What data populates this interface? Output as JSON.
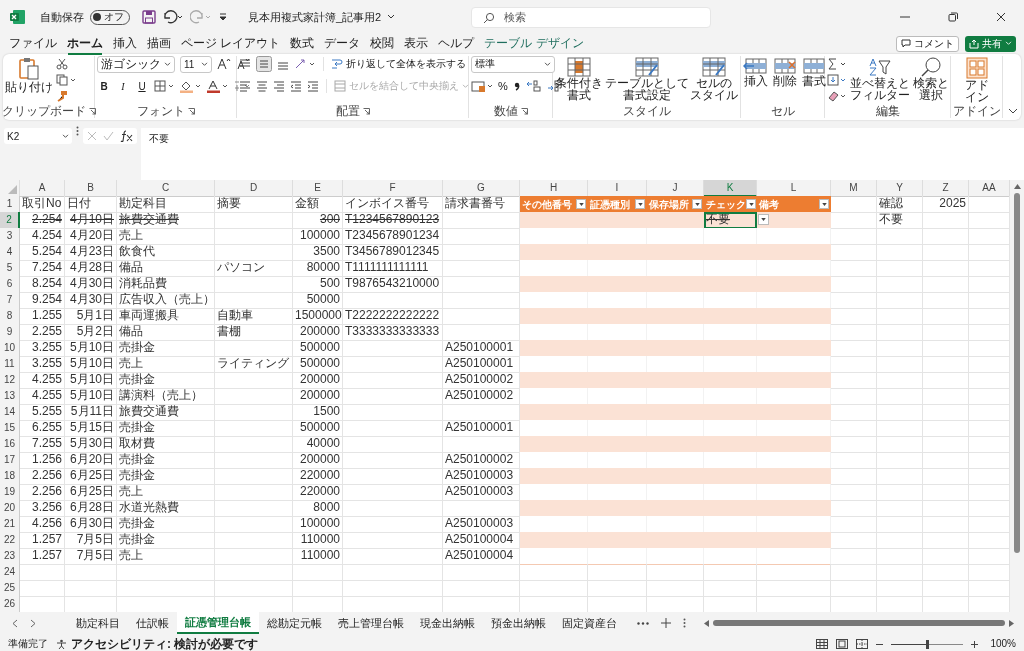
{
  "title_bar": {
    "autosave_label": "自動保存",
    "autosave": {
      "label": "オフ",
      "on": false
    },
    "file_name": "見本用複式家計簿_記事用2",
    "search": {
      "placeholder": "検索"
    }
  },
  "menu": {
    "tabs": [
      {
        "label": "ファイル",
        "selected": false,
        "contextual": false
      },
      {
        "label": "ホーム",
        "selected": true,
        "contextual": false
      },
      {
        "label": "挿入",
        "selected": false,
        "contextual": false
      },
      {
        "label": "描画",
        "selected": false,
        "contextual": false
      },
      {
        "label": "ページ レイアウト",
        "selected": false,
        "contextual": false
      },
      {
        "label": "数式",
        "selected": false,
        "contextual": false
      },
      {
        "label": "データ",
        "selected": false,
        "contextual": false
      },
      {
        "label": "校閲",
        "selected": false,
        "contextual": false
      },
      {
        "label": "表示",
        "selected": false,
        "contextual": false
      },
      {
        "label": "ヘルプ",
        "selected": false,
        "contextual": false
      },
      {
        "label": "テーブル デザイン",
        "selected": false,
        "contextual": true
      }
    ],
    "comment_button": "コメント",
    "share_button": "共有"
  },
  "ribbon": {
    "groups": [
      {
        "kind": "clipboard",
        "label": "クリップボード",
        "paste": "貼り付け"
      },
      {
        "kind": "font",
        "label": "フォント",
        "font": "游ゴシック",
        "size": "11",
        "styles": [
          "B",
          "I",
          "U"
        ]
      },
      {
        "kind": "alignment",
        "label": "配置",
        "wrap": "折り返して全体を表示する",
        "merge": {
          "label": "セルを結合して中央揃え",
          "disabled": true
        }
      },
      {
        "kind": "number",
        "label": "数値",
        "format": "標準",
        "symbols": [
          "%"
        ]
      },
      {
        "kind": "styles",
        "label": "スタイル",
        "buttons": [
          {
            "lines": [
              "条件付き",
              "書式"
            ]
          },
          {
            "lines": [
              "テーブルとして",
              "書式設定"
            ]
          },
          {
            "lines": [
              "セルの",
              "スタイル"
            ]
          }
        ]
      },
      {
        "kind": "cells",
        "label": "セル",
        "buttons": [
          {
            "lines": [
              "挿入"
            ]
          },
          {
            "lines": [
              "削除"
            ]
          },
          {
            "lines": [
              "書式"
            ]
          }
        ]
      },
      {
        "kind": "editing",
        "label": "編集",
        "buttons": [
          {
            "lines": [
              "並べ替えと",
              "フィルター"
            ]
          },
          {
            "lines": [
              "検索と",
              "選択"
            ]
          }
        ]
      },
      {
        "kind": "addins",
        "label": "アドイン",
        "buttons": [
          {
            "lines": [
              "アド",
              "イン"
            ]
          }
        ]
      }
    ]
  },
  "formula_bar": {
    "name_box": "K2",
    "formula": "不要"
  },
  "grid": {
    "columns": [
      {
        "label": "A",
        "selected": false,
        "table": false
      },
      {
        "label": "B",
        "selected": false,
        "table": false
      },
      {
        "label": "C",
        "selected": false,
        "table": false
      },
      {
        "label": "D",
        "selected": false,
        "table": false
      },
      {
        "label": "E",
        "selected": false,
        "table": false
      },
      {
        "label": "F",
        "selected": false,
        "table": false
      },
      {
        "label": "G",
        "selected": false,
        "table": false
      },
      {
        "label": "H",
        "selected": false,
        "table": true
      },
      {
        "label": "I",
        "selected": false,
        "table": true
      },
      {
        "label": "J",
        "selected": false,
        "table": true
      },
      {
        "label": "K",
        "selected": true,
        "table": true
      },
      {
        "label": "L",
        "selected": false,
        "table": true
      },
      {
        "label": "M",
        "selected": false,
        "table": false
      },
      {
        "label": "Y",
        "selected": false,
        "table": false
      },
      {
        "label": "Z",
        "selected": false,
        "table": false
      },
      {
        "label": "AA",
        "selected": false,
        "table": false
      }
    ],
    "rows": [
      {
        "n": "1",
        "kind": "header",
        "selected": false,
        "struck": false,
        "cells": [
          "取引No",
          "日付",
          "勘定科目",
          "摘要",
          "金額",
          "インボイス番号",
          "請求書番号",
          "その他番号",
          "証憑種別",
          "保存場所",
          "チェック",
          "備考",
          null,
          "確認",
          "2025"
        ]
      },
      {
        "n": "2",
        "kind": "body",
        "selected": true,
        "struck": true,
        "cells": [
          "2.254",
          "4月10日",
          "旅費交通費",
          null,
          "300",
          "T1234567890123",
          null,
          null,
          null,
          null,
          "不要",
          null,
          null,
          "不要"
        ]
      },
      {
        "n": "3",
        "kind": "body",
        "selected": false,
        "struck": false,
        "cells": [
          "4.254",
          "4月20日",
          "売上",
          null,
          "100000",
          "T2345678901234"
        ]
      },
      {
        "n": "4",
        "kind": "body",
        "selected": false,
        "struck": false,
        "cells": [
          "5.254",
          "4月23日",
          "飲食代",
          null,
          "3500",
          "T3456789012345"
        ]
      },
      {
        "n": "5",
        "kind": "body",
        "selected": false,
        "struck": false,
        "cells": [
          "7.254",
          "4月28日",
          "備品",
          "パソコン",
          "80000",
          "T1111111111111"
        ]
      },
      {
        "n": "6",
        "kind": "body",
        "selected": false,
        "struck": false,
        "cells": [
          "8.254",
          "4月30日",
          "消耗品費",
          null,
          "500",
          "T9876543210000"
        ]
      },
      {
        "n": "7",
        "kind": "body",
        "selected": false,
        "struck": false,
        "cells": [
          "9.254",
          "4月30日",
          "広告収入（売上）",
          null,
          "50000"
        ]
      },
      {
        "n": "8",
        "kind": "body",
        "selected": false,
        "struck": false,
        "cells": [
          "1.255",
          "5月1日",
          "車両運搬具",
          "自動車",
          "1500000",
          "T2222222222222"
        ]
      },
      {
        "n": "9",
        "kind": "body",
        "selected": false,
        "struck": false,
        "cells": [
          "2.255",
          "5月2日",
          "備品",
          "書棚",
          "200000",
          "T3333333333333"
        ]
      },
      {
        "n": "10",
        "kind": "body",
        "selected": false,
        "struck": false,
        "cells": [
          "3.255",
          "5月10日",
          "売掛金",
          null,
          "500000",
          null,
          "A250100001"
        ]
      },
      {
        "n": "11",
        "kind": "body",
        "selected": false,
        "struck": false,
        "cells": [
          "3.255",
          "5月10日",
          "売上",
          "ライティング",
          "500000",
          null,
          "A250100001"
        ]
      },
      {
        "n": "12",
        "kind": "body",
        "selected": false,
        "struck": false,
        "cells": [
          "4.255",
          "5月10日",
          "売掛金",
          null,
          "200000",
          null,
          "A250100002"
        ]
      },
      {
        "n": "13",
        "kind": "body",
        "selected": false,
        "struck": false,
        "cells": [
          "4.255",
          "5月10日",
          "講演料（売上）",
          null,
          "200000",
          null,
          "A250100002"
        ]
      },
      {
        "n": "14",
        "kind": "body",
        "selected": false,
        "struck": false,
        "cells": [
          "5.255",
          "5月11日",
          "旅費交通費",
          null,
          "1500"
        ]
      },
      {
        "n": "15",
        "kind": "body",
        "selected": false,
        "struck": false,
        "cells": [
          "6.255",
          "5月15日",
          "売掛金",
          null,
          "500000",
          null,
          "A250100001"
        ]
      },
      {
        "n": "16",
        "kind": "body",
        "selected": false,
        "struck": false,
        "cells": [
          "7.255",
          "5月30日",
          "取材費",
          null,
          "40000"
        ]
      },
      {
        "n": "17",
        "kind": "body",
        "selected": false,
        "struck": false,
        "cells": [
          "1.256",
          "6月20日",
          "売掛金",
          null,
          "200000",
          null,
          "A250100002"
        ]
      },
      {
        "n": "18",
        "kind": "body",
        "selected": false,
        "struck": false,
        "cells": [
          "2.256",
          "6月25日",
          "売掛金",
          null,
          "220000",
          null,
          "A250100003"
        ]
      },
      {
        "n": "19",
        "kind": "body",
        "selected": false,
        "struck": false,
        "cells": [
          "2.256",
          "6月25日",
          "売上",
          null,
          "220000",
          null,
          "A250100003"
        ]
      },
      {
        "n": "20",
        "kind": "body",
        "selected": false,
        "struck": false,
        "cells": [
          "3.256",
          "6月28日",
          "水道光熱費",
          null,
          "8000"
        ]
      },
      {
        "n": "21",
        "kind": "body",
        "selected": false,
        "struck": false,
        "cells": [
          "4.256",
          "6月30日",
          "売掛金",
          null,
          "100000",
          null,
          "A250100003"
        ]
      },
      {
        "n": "22",
        "kind": "body",
        "selected": false,
        "struck": false,
        "cells": [
          "1.257",
          "7月5日",
          "売掛金",
          null,
          "110000",
          null,
          "A250100004"
        ]
      },
      {
        "n": "23",
        "kind": "body",
        "selected": false,
        "struck": false,
        "cells": [
          "1.257",
          "7月5日",
          "売上",
          null,
          "110000",
          null,
          "A250100004"
        ]
      },
      {
        "n": "24",
        "kind": "blank",
        "selected": false,
        "cells": []
      },
      {
        "n": "25",
        "kind": "blank",
        "selected": false,
        "cells": []
      },
      {
        "n": "26",
        "kind": "blank",
        "selected": false,
        "cells": []
      }
    ]
  },
  "sheet_tabs": [
    {
      "label": "勘定科目",
      "selected": false
    },
    {
      "label": "仕訳帳",
      "selected": false
    },
    {
      "label": "証憑管理台帳",
      "selected": true
    },
    {
      "label": "総勘定元帳",
      "selected": false
    },
    {
      "label": "売上管理台帳",
      "selected": false
    },
    {
      "label": "現金出納帳",
      "selected": false
    },
    {
      "label": "預金出納帳",
      "selected": false
    },
    {
      "label": "固定資産台",
      "selected": false
    }
  ],
  "status_bar": {
    "ready": "準備完了",
    "accessibility": "アクセシビリティ: 検討が必要です",
    "zoom": {
      "level": 0.5,
      "label": "100%"
    }
  }
}
